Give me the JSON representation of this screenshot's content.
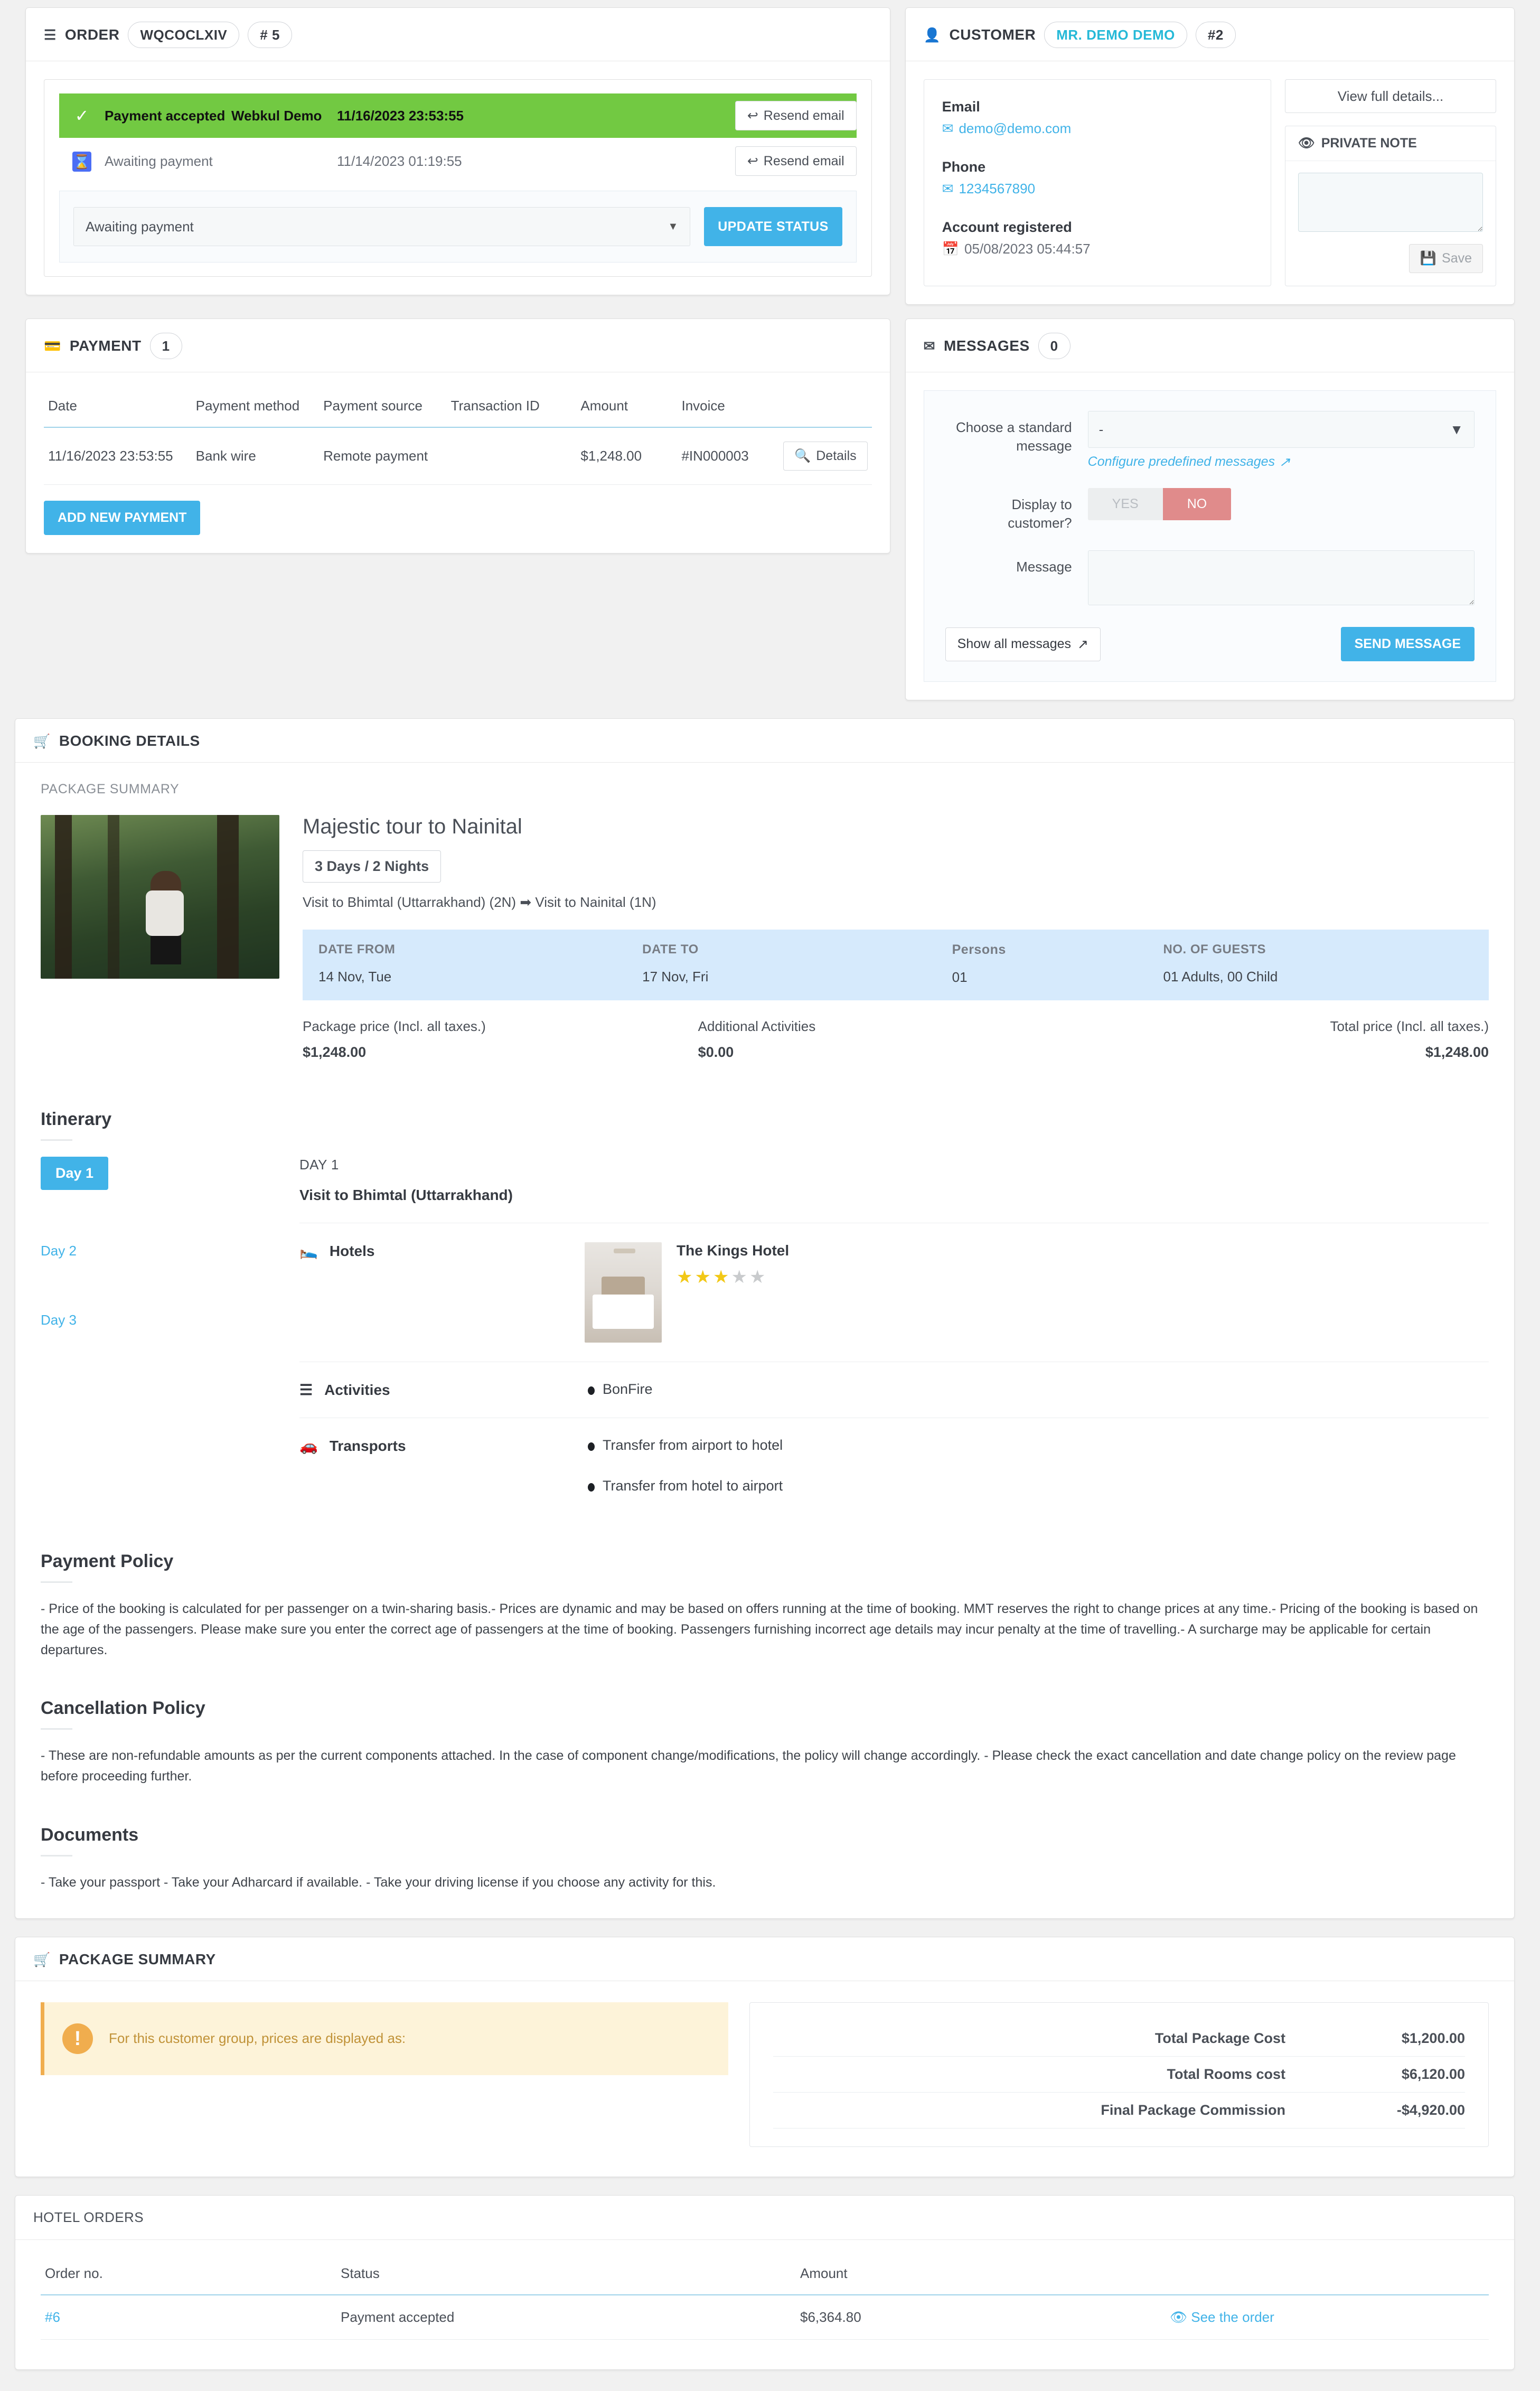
{
  "order": {
    "title": "ORDER",
    "reference": "WQCOCLXIV",
    "number": "# 5",
    "statuses": [
      {
        "icon": "check-icon",
        "name": "Payment accepted",
        "employee": "Webkul Demo",
        "date": "11/16/2023 23:53:55",
        "action": "Resend email"
      },
      {
        "icon": "hourglass-icon",
        "name": "Awaiting payment",
        "employee": "",
        "date": "11/14/2023 01:19:55",
        "action": "Resend email"
      }
    ],
    "status_select_value": "Awaiting payment",
    "update_status_label": "UPDATE STATUS"
  },
  "customer": {
    "title": "CUSTOMER",
    "name": "MR. DEMO DEMO",
    "id": "#2",
    "email_label": "Email",
    "email_value": "demo@demo.com",
    "phone_label": "Phone",
    "phone_value": "1234567890",
    "registered_label": "Account registered",
    "registered_value": "05/08/2023 05:44:57",
    "view_full_details": "View full details...",
    "private_note_title": "PRIVATE NOTE",
    "private_note_value": "",
    "save_label": "Save"
  },
  "payment": {
    "title": "PAYMENT",
    "count": "1",
    "columns": [
      "Date",
      "Payment method",
      "Payment source",
      "Transaction ID",
      "Amount",
      "Invoice",
      ""
    ],
    "rows": [
      {
        "date": "11/16/2023 23:53:55",
        "method": "Bank wire",
        "source": "Remote payment",
        "transaction_id": "",
        "amount": "$1,248.00",
        "invoice": "#IN000003",
        "details_label": "Details"
      }
    ],
    "add_new_payment": "ADD NEW PAYMENT"
  },
  "messages": {
    "title": "MESSAGES",
    "count": "0",
    "standard_message_label": "Choose a standard message",
    "standard_message_value": "-",
    "configure_link": "Configure predefined messages",
    "display_label": "Display to customer?",
    "toggle_yes": "YES",
    "toggle_no": "NO",
    "message_label": "Message",
    "message_value": "",
    "show_all": "Show all messages",
    "send": "SEND MESSAGE"
  },
  "booking": {
    "title": "BOOKING DETAILS",
    "package_summary_label": "PACKAGE SUMMARY",
    "package_title": "Majestic tour to Nainital",
    "duration_badge": "3 Days / 2 Nights",
    "route": "Visit to Bhimtal (Uttarrakhand) (2N) ➡ Visit to Nainital (1N)",
    "info": {
      "date_from_label": "DATE FROM",
      "date_from_value": "14 Nov, Tue",
      "date_to_label": "DATE TO",
      "date_to_value": "17 Nov, Fri",
      "persons_label": "Persons",
      "persons_value": "01",
      "guests_label": "NO. OF GUESTS",
      "guests_value": "01 Adults, 00 Child"
    },
    "prices": {
      "package_price_label": "Package price (Incl. all taxes.)",
      "package_price_value": "$1,248.00",
      "additional_label": "Additional Activities",
      "additional_value": "$0.00",
      "total_label": "Total price (Incl. all taxes.)",
      "total_value": "$1,248.00"
    },
    "itinerary_heading": "Itinerary",
    "days": [
      {
        "label": "Day 1",
        "active": true
      },
      {
        "label": "Day 2",
        "active": false
      },
      {
        "label": "Day 3",
        "active": false
      }
    ],
    "day_kicker": "DAY 1",
    "day_title": "Visit to Bhimtal (Uttarrakhand)",
    "hotels_label": "Hotels",
    "hotel_name": "The Kings Hotel",
    "hotel_stars_filled": 3,
    "hotel_stars_total": 5,
    "activities_label": "Activities",
    "activities": [
      "BonFire"
    ],
    "transports_label": "Transports",
    "transports": [
      "Transfer from airport to hotel",
      "Transfer from hotel to airport"
    ],
    "payment_policy_heading": "Payment Policy",
    "payment_policy_text": "- Price of the booking is calculated for per passenger on a twin-sharing basis.- Prices are dynamic and may be based on offers running at the time of booking. MMT reserves the right to change prices at any time.- Pricing of the booking is based on the age of the passengers. Please make sure you enter the correct age of passengers at the time of booking. Passengers furnishing incorrect age details may incur penalty at the time of travelling.- A surcharge may be applicable for certain departures.",
    "cancellation_policy_heading": "Cancellation Policy",
    "cancellation_policy_text": "- These are non-refundable amounts as per the current components attached. In the case of component change/modifications, the policy will change accordingly. - Please check the exact cancellation and date change policy on the review page before proceeding further.",
    "documents_heading": "Documents",
    "documents_text": "- Take your passport - Take your Adharcard if available. - Take your driving license if you choose any activity for this."
  },
  "package_summary": {
    "title": "PACKAGE SUMMARY",
    "alert_text": "For this customer group, prices are displayed as:",
    "totals": [
      {
        "label": "Total Package Cost",
        "value": "$1,200.00"
      },
      {
        "label": "Total Rooms cost",
        "value": "$6,120.00"
      },
      {
        "label": "Final Package Commission",
        "value": "-$4,920.00"
      }
    ]
  },
  "hotel_orders": {
    "title": "HOTEL ORDERS",
    "columns": [
      "Order no.",
      "Status",
      "Amount",
      ""
    ],
    "rows": [
      {
        "order_no": "#6",
        "status": "Payment accepted",
        "amount": "$6,364.80",
        "link": "See the order"
      }
    ]
  },
  "colors": {
    "accent": "#41b3e8",
    "success": "#72c942",
    "warning": "#f0ad4e",
    "danger": "#e08b8b",
    "info_strip": "#d6eafc"
  }
}
